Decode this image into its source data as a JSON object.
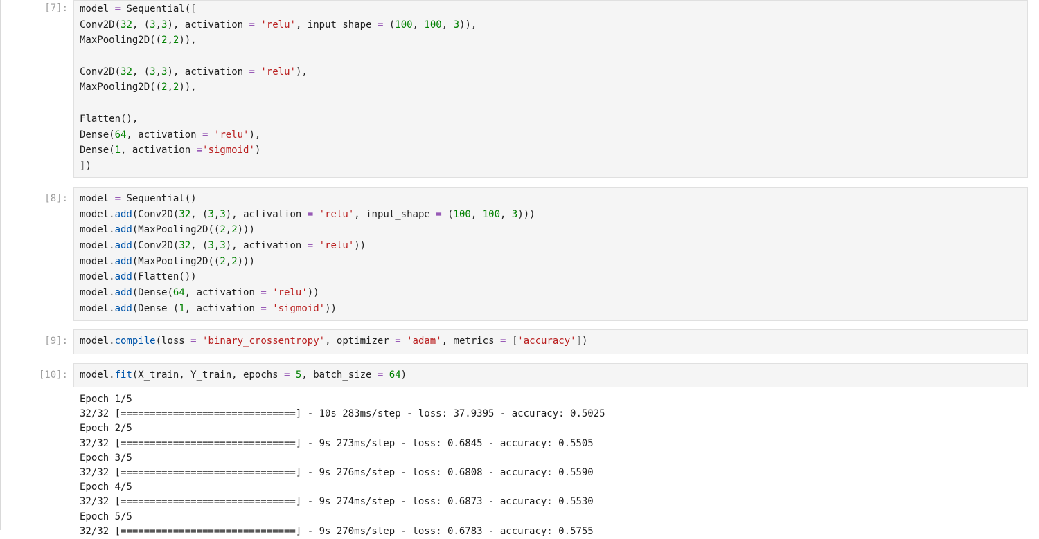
{
  "cells": [
    {
      "prompt": "[7]:",
      "lines": [
        [
          [
            "model ",
            ""
          ],
          [
            "=",
            "k"
          ],
          [
            " Sequential(",
            ""
          ],
          [
            "[",
            "b"
          ]
        ],
        [
          [
            "Conv2D(",
            ""
          ],
          [
            "32",
            "n"
          ],
          [
            ", (",
            ""
          ],
          [
            "3",
            "n"
          ],
          [
            ",",
            ""
          ],
          [
            "3",
            "n"
          ],
          [
            "), activation ",
            ""
          ],
          [
            "=",
            "k"
          ],
          [
            " ",
            ""
          ],
          [
            "'relu'",
            "s"
          ],
          [
            ", input_shape ",
            ""
          ],
          [
            "=",
            "k"
          ],
          [
            " (",
            ""
          ],
          [
            "100",
            "n"
          ],
          [
            ", ",
            ""
          ],
          [
            "100",
            "n"
          ],
          [
            ", ",
            ""
          ],
          [
            "3",
            "n"
          ],
          [
            ")),",
            ""
          ]
        ],
        [
          [
            "MaxPooling2D((",
            ""
          ],
          [
            "2",
            "n"
          ],
          [
            ",",
            ""
          ],
          [
            "2",
            "n"
          ],
          [
            ")),",
            ""
          ]
        ],
        [],
        [
          [
            "Conv2D(",
            ""
          ],
          [
            "32",
            "n"
          ],
          [
            ", (",
            ""
          ],
          [
            "3",
            "n"
          ],
          [
            ",",
            ""
          ],
          [
            "3",
            "n"
          ],
          [
            "), activation ",
            ""
          ],
          [
            "=",
            "k"
          ],
          [
            " ",
            ""
          ],
          [
            "'relu'",
            "s"
          ],
          [
            "),",
            ""
          ]
        ],
        [
          [
            "MaxPooling2D((",
            ""
          ],
          [
            "2",
            "n"
          ],
          [
            ",",
            ""
          ],
          [
            "2",
            "n"
          ],
          [
            ")),",
            ""
          ]
        ],
        [],
        [
          [
            "Flatten(),",
            ""
          ]
        ],
        [
          [
            "Dense(",
            ""
          ],
          [
            "64",
            "n"
          ],
          [
            ", activation ",
            ""
          ],
          [
            "=",
            "k"
          ],
          [
            " ",
            ""
          ],
          [
            "'relu'",
            "s"
          ],
          [
            "),",
            ""
          ]
        ],
        [
          [
            "Dense(",
            ""
          ],
          [
            "1",
            "n"
          ],
          [
            ", activation ",
            ""
          ],
          [
            "=",
            "k"
          ],
          [
            "'sigmoid'",
            "s"
          ],
          [
            ")",
            ""
          ]
        ],
        [
          [
            "]",
            "b"
          ],
          [
            ")",
            ""
          ]
        ]
      ]
    },
    {
      "prompt": "[8]:",
      "lines": [
        [
          [
            "model ",
            ""
          ],
          [
            "=",
            "k"
          ],
          [
            " Sequential()",
            ""
          ]
        ],
        [
          [
            "model.",
            ""
          ],
          [
            "add",
            "f"
          ],
          [
            "(Conv2D(",
            ""
          ],
          [
            "32",
            "n"
          ],
          [
            ", (",
            ""
          ],
          [
            "3",
            "n"
          ],
          [
            ",",
            ""
          ],
          [
            "3",
            "n"
          ],
          [
            "), activation ",
            ""
          ],
          [
            "=",
            "k"
          ],
          [
            " ",
            ""
          ],
          [
            "'relu'",
            "s"
          ],
          [
            ", input_shape ",
            ""
          ],
          [
            "=",
            "k"
          ],
          [
            " (",
            ""
          ],
          [
            "100",
            "n"
          ],
          [
            ", ",
            ""
          ],
          [
            "100",
            "n"
          ],
          [
            ", ",
            ""
          ],
          [
            "3",
            "n"
          ],
          [
            ")))",
            ""
          ]
        ],
        [
          [
            "model.",
            ""
          ],
          [
            "add",
            "f"
          ],
          [
            "(MaxPooling2D((",
            ""
          ],
          [
            "2",
            "n"
          ],
          [
            ",",
            ""
          ],
          [
            "2",
            "n"
          ],
          [
            ")))",
            ""
          ]
        ],
        [
          [
            "model.",
            ""
          ],
          [
            "add",
            "f"
          ],
          [
            "(Conv2D(",
            ""
          ],
          [
            "32",
            "n"
          ],
          [
            ", (",
            ""
          ],
          [
            "3",
            "n"
          ],
          [
            ",",
            ""
          ],
          [
            "3",
            "n"
          ],
          [
            "), activation ",
            ""
          ],
          [
            "=",
            "k"
          ],
          [
            " ",
            ""
          ],
          [
            "'relu'",
            "s"
          ],
          [
            "))",
            ""
          ]
        ],
        [
          [
            "model.",
            ""
          ],
          [
            "add",
            "f"
          ],
          [
            "(MaxPooling2D((",
            ""
          ],
          [
            "2",
            "n"
          ],
          [
            ",",
            ""
          ],
          [
            "2",
            "n"
          ],
          [
            ")))",
            ""
          ]
        ],
        [
          [
            "model.",
            ""
          ],
          [
            "add",
            "f"
          ],
          [
            "(Flatten())",
            ""
          ]
        ],
        [
          [
            "model.",
            ""
          ],
          [
            "add",
            "f"
          ],
          [
            "(Dense(",
            ""
          ],
          [
            "64",
            "n"
          ],
          [
            ", activation ",
            ""
          ],
          [
            "=",
            "k"
          ],
          [
            " ",
            ""
          ],
          [
            "'relu'",
            "s"
          ],
          [
            "))",
            ""
          ]
        ],
        [
          [
            "model.",
            ""
          ],
          [
            "add",
            "f"
          ],
          [
            "(Dense (",
            ""
          ],
          [
            "1",
            "n"
          ],
          [
            ", activation ",
            ""
          ],
          [
            "=",
            "k"
          ],
          [
            " ",
            ""
          ],
          [
            "'sigmoid'",
            "s"
          ],
          [
            "))",
            ""
          ]
        ]
      ]
    },
    {
      "prompt": "[9]:",
      "lines": [
        [
          [
            "model.",
            ""
          ],
          [
            "compile",
            "f"
          ],
          [
            "(loss ",
            ""
          ],
          [
            "=",
            "k"
          ],
          [
            " ",
            ""
          ],
          [
            "'binary_crossentropy'",
            "s"
          ],
          [
            ", optimizer ",
            ""
          ],
          [
            "=",
            "k"
          ],
          [
            " ",
            ""
          ],
          [
            "'adam'",
            "s"
          ],
          [
            ", metrics ",
            ""
          ],
          [
            "=",
            "k"
          ],
          [
            " ",
            ""
          ],
          [
            "[",
            "b"
          ],
          [
            "'accuracy'",
            "s"
          ],
          [
            "]",
            "b"
          ],
          [
            ")",
            ""
          ]
        ]
      ]
    },
    {
      "prompt": "[10]:",
      "lines": [
        [
          [
            "model.",
            ""
          ],
          [
            "fit",
            "f"
          ],
          [
            "(X_train, Y_train, epochs ",
            ""
          ],
          [
            "=",
            "k"
          ],
          [
            " ",
            ""
          ],
          [
            "5",
            "n"
          ],
          [
            ", batch_size ",
            ""
          ],
          [
            "=",
            "k"
          ],
          [
            " ",
            ""
          ],
          [
            "64",
            "n"
          ],
          [
            ")",
            ""
          ]
        ]
      ]
    }
  ],
  "output": [
    "Epoch 1/5",
    "32/32 [==============================] - 10s 283ms/step - loss: 37.9395 - accuracy: 0.5025",
    "Epoch 2/5",
    "32/32 [==============================] - 9s 273ms/step - loss: 0.6845 - accuracy: 0.5505",
    "Epoch 3/5",
    "32/32 [==============================] - 9s 276ms/step - loss: 0.6808 - accuracy: 0.5590",
    "Epoch 4/5",
    "32/32 [==============================] - 9s 274ms/step - loss: 0.6873 - accuracy: 0.5530",
    "Epoch 5/5",
    "32/32 [==============================] - 9s 270ms/step - loss: 0.6783 - accuracy: 0.5755"
  ]
}
